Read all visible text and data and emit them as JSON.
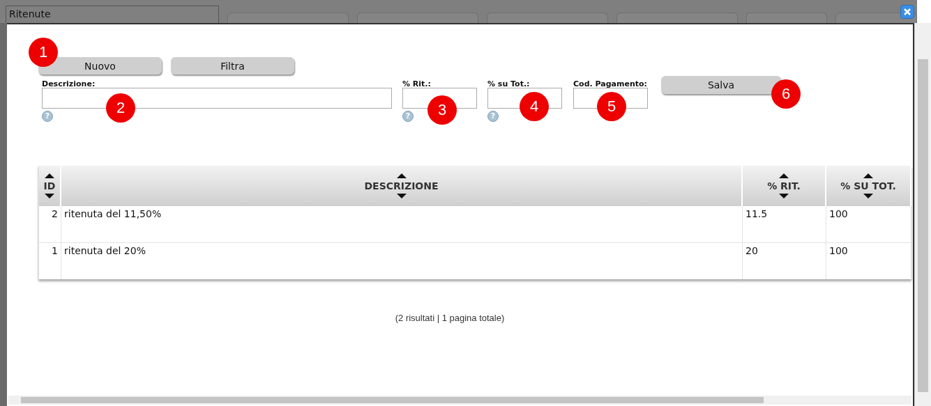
{
  "window": {
    "title": "Ritenute"
  },
  "toolbar": {
    "buttons": [
      "Nuovo",
      "Filtra"
    ]
  },
  "form": {
    "fields": [
      {
        "label": "Descrizione:",
        "hint": "?"
      },
      {
        "label": "% Rit.:",
        "hint": "?"
      },
      {
        "label": "% su Tot.:",
        "hint": "?"
      },
      {
        "label": "Cod. Pagamento:"
      }
    ],
    "save_button": "Salva"
  },
  "table": {
    "columns": [
      "ID",
      "DESCRIZIONE",
      "% RIT.",
      "% SU TOT."
    ],
    "rows": [
      [
        "2",
        "ritenuta del 11,50%",
        "11.5",
        "100"
      ],
      [
        "1",
        "ritenuta del 20%",
        "20",
        "100"
      ]
    ]
  },
  "status": "(2 risultati | 1 pagina totale)",
  "callouts": [
    "1",
    "2",
    "3",
    "4",
    "5",
    "6"
  ]
}
